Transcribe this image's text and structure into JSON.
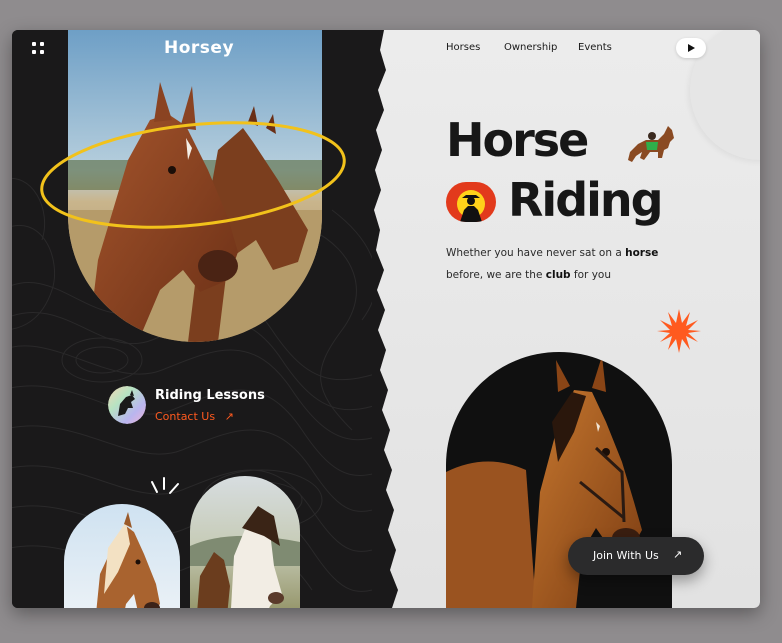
{
  "brand": {
    "logo": "Horsey"
  },
  "nav": {
    "items": [
      "Horses",
      "Ownership",
      "Events"
    ]
  },
  "hero": {
    "title_line1": "Horse",
    "title_line2": "Riding",
    "subtitle_parts": [
      "Whether you have never sat on a ",
      "horse",
      " before, we are the ",
      "club",
      " for you"
    ]
  },
  "lesson": {
    "title": "Riding Lessons",
    "link": "Contact Us",
    "arrow": "↗"
  },
  "cta": {
    "label": "Join With Us",
    "arrow": "↗"
  },
  "icons": {
    "menu": "grid-dots-icon",
    "play": "play-icon",
    "race_horse": "race-horse-icon",
    "rider": "cowboy-rider-icon",
    "burst": "sun-burst-icon"
  },
  "colors": {
    "accent": "#ff5a1f",
    "ring": "#f2c21b",
    "dark": "#1a191a",
    "light": "#e8e8e8"
  }
}
